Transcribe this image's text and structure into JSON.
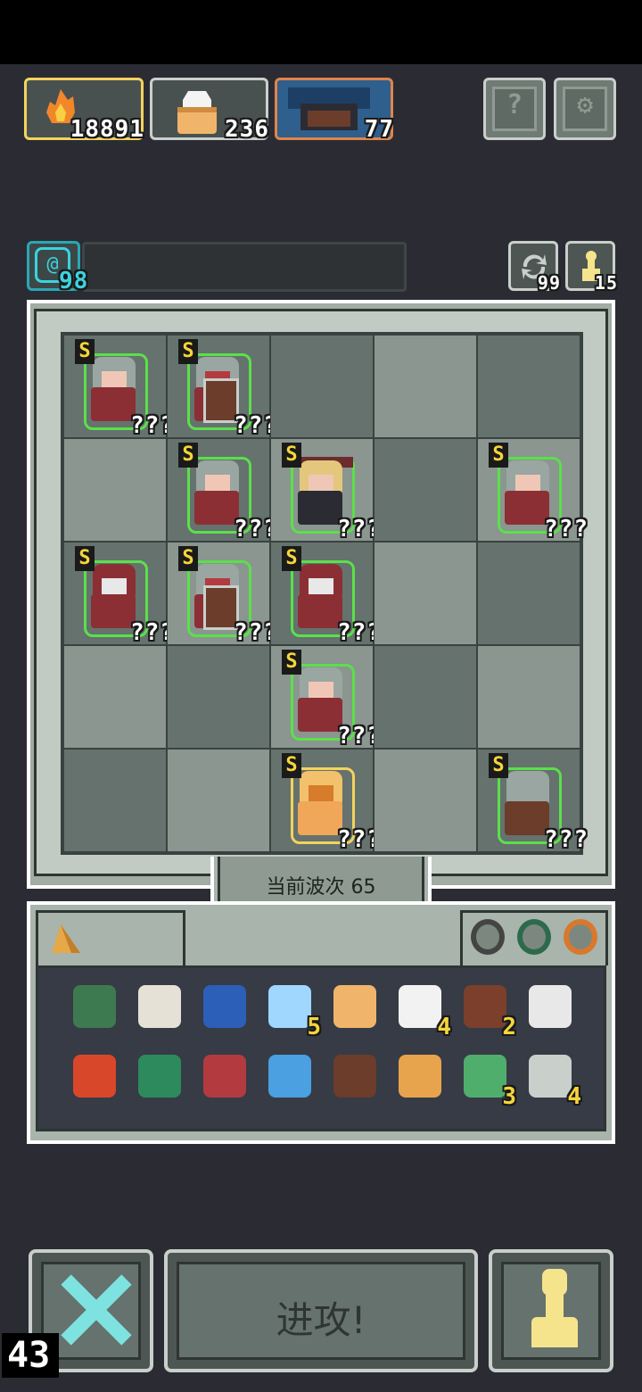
{
  "resources": [
    {
      "name": "fire",
      "value": "18891",
      "border": "#f3d35e"
    },
    {
      "name": "bag",
      "value": "236",
      "border": "#c9cfcb"
    },
    {
      "name": "hero",
      "value": "77",
      "border": "#e0844a"
    }
  ],
  "top_buttons": {
    "help_glyph": "?",
    "settings_glyph": "⚙"
  },
  "special": {
    "glyph": "@",
    "value": "98"
  },
  "side_buttons": {
    "refresh_count": "99",
    "pawn_count": "15"
  },
  "units": [
    {
      "row": 0,
      "col": 0,
      "kind": "spear",
      "rank": "S",
      "label": "???"
    },
    {
      "row": 0,
      "col": 1,
      "kind": "shield",
      "rank": "S",
      "label": "???"
    },
    {
      "row": 1,
      "col": 1,
      "kind": "spear",
      "rank": "S",
      "label": "???"
    },
    {
      "row": 1,
      "col": 2,
      "kind": "archer",
      "rank": "S",
      "label": "???"
    },
    {
      "row": 1,
      "col": 4,
      "kind": "spear",
      "rank": "S",
      "label": "???"
    },
    {
      "row": 2,
      "col": 0,
      "kind": "mage",
      "rank": "S",
      "label": "???"
    },
    {
      "row": 2,
      "col": 1,
      "kind": "shield",
      "rank": "S",
      "label": "???"
    },
    {
      "row": 2,
      "col": 2,
      "kind": "mage",
      "rank": "S",
      "label": "???"
    },
    {
      "row": 3,
      "col": 2,
      "kind": "spear",
      "rank": "S",
      "label": "???"
    },
    {
      "row": 4,
      "col": 2,
      "kind": "knight",
      "rank": "S",
      "label": "???"
    },
    {
      "row": 4,
      "col": 4,
      "kind": "tower",
      "rank": "S",
      "label": "???"
    }
  ],
  "wave": {
    "text": "当前波次 65"
  },
  "inventory_row1": [
    {
      "name": "turtle-shell",
      "color": "#3d7a4f",
      "count": ""
    },
    {
      "name": "scroll",
      "color": "#e6e1d6",
      "count": ""
    },
    {
      "name": "mask",
      "color": "#2c5fb8",
      "count": ""
    },
    {
      "name": "orb",
      "color": "#9fd7ff",
      "count": "5"
    },
    {
      "name": "bag",
      "color": "#f0b56a",
      "count": ""
    },
    {
      "name": "egg",
      "color": "#f2f2f2",
      "count": "4"
    },
    {
      "name": "book",
      "color": "#7b3f2b",
      "count": "2"
    },
    {
      "name": "key",
      "color": "#e8e8e8",
      "count": ""
    }
  ],
  "inventory_row2": [
    {
      "name": "gem",
      "color": "#d9472a",
      "count": ""
    },
    {
      "name": "potion-flask",
      "color": "#2d8a5d",
      "count": ""
    },
    {
      "name": "helmet",
      "color": "#b33b40",
      "count": ""
    },
    {
      "name": "armor",
      "color": "#4aa0e0",
      "count": ""
    },
    {
      "name": "mystery-chest",
      "color": "#6b3d2a",
      "count": ""
    },
    {
      "name": "fox",
      "color": "#e7a44d",
      "count": ""
    },
    {
      "name": "green-potion",
      "color": "#4fae6c",
      "count": "3"
    },
    {
      "name": "crate",
      "color": "#c9cfcb",
      "count": "4"
    }
  ],
  "rings": [
    {
      "name": "ring-dark",
      "color": "#4a5358"
    },
    {
      "name": "ring-green",
      "color": "#2d6a4c"
    },
    {
      "name": "ring-orange",
      "color": "#d9782c"
    }
  ],
  "actions": {
    "attack_label": "进攻!"
  },
  "corner_count": "43"
}
